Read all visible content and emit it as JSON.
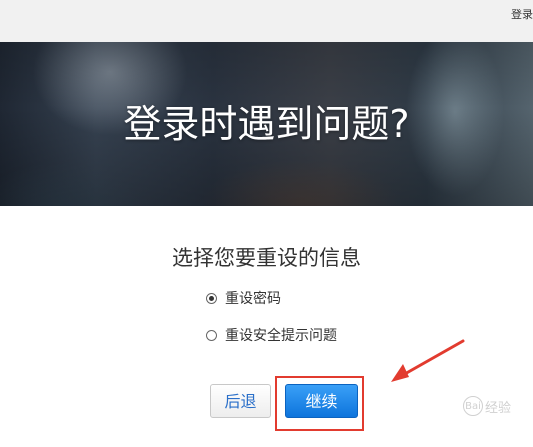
{
  "topbar": {
    "login_link": "登录"
  },
  "hero": {
    "title": "登录时遇到问题?"
  },
  "form": {
    "prompt": "选择您要重设的信息",
    "options": [
      {
        "label": "重设密码",
        "selected": true
      },
      {
        "label": "重设安全提示问题",
        "selected": false
      }
    ],
    "back_label": "后退",
    "continue_label": "继续"
  },
  "annotation": {
    "highlight_color": "#e23b2f",
    "target": "continue-button"
  },
  "watermark": {
    "text": "经验",
    "badge": "Bai"
  },
  "colors": {
    "continue_button": "#1a7fe3",
    "back_text": "#2a6fc9"
  }
}
